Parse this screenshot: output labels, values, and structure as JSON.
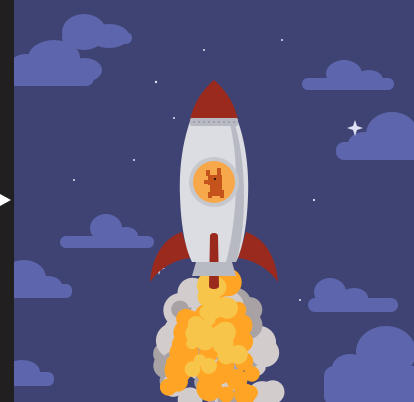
{
  "scene": {
    "colors": {
      "sky": "#3f4373",
      "cloud": "#5d66ad",
      "cloud_shade": "#535aa0",
      "star": "#dfe2f5",
      "rocket_body": "#dcdde2",
      "rocket_shade": "#b8bac3",
      "rocket_red": "#9b2a1e",
      "rocket_red_dark": "#7a1e15",
      "window_bg": "#f7a84a",
      "window_rim": "#c7c8ce",
      "fox": "#c5541c",
      "flame_core": "#ffa424",
      "flame_mid": "#f7c54a",
      "smoke": "#d2cccc",
      "smoke_dark": "#a8a2a4"
    },
    "icons": {
      "play_arrow": "play-arrow-icon",
      "rocket": "rocket-icon",
      "fox": "fox-icon"
    }
  }
}
